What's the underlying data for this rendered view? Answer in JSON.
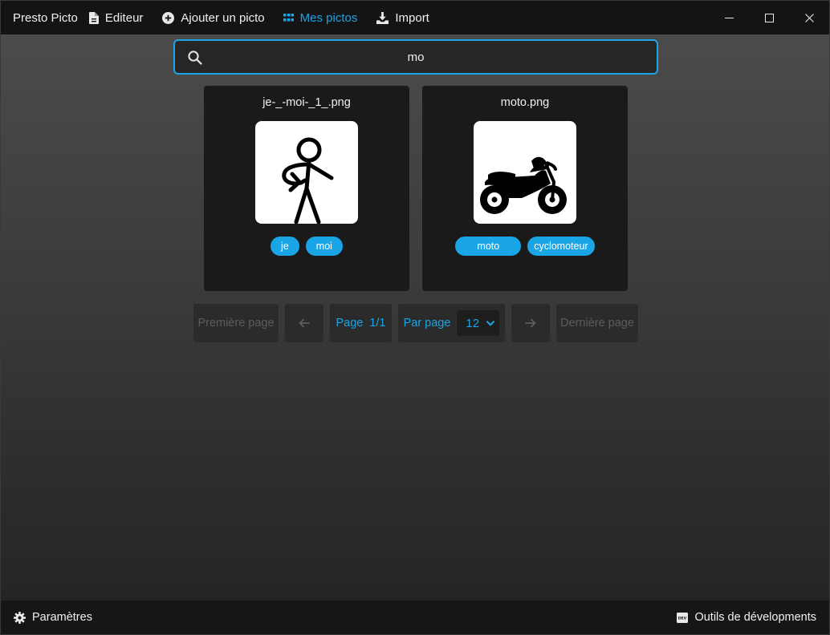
{
  "app": {
    "title": "Presto Picto"
  },
  "nav": {
    "editor": "Editeur",
    "add": "Ajouter un picto",
    "mine": "Mes pictos",
    "import": "Import"
  },
  "search": {
    "value": "mo"
  },
  "cards": [
    {
      "title": "je-_-moi-_1_.png",
      "image": "stick-figure-pointing-self",
      "tags": [
        "je",
        "moi"
      ]
    },
    {
      "title": "moto.png",
      "image": "motorcycle",
      "tags": [
        "moto",
        "cyclomoteur"
      ]
    }
  ],
  "pagination": {
    "first": "Première page",
    "prev_icon": "arrow-left-icon",
    "page_label": "Page",
    "page_value": "1/1",
    "per_page_label": "Par page",
    "per_page_value": "12",
    "next_icon": "arrow-right-icon",
    "last": "Dernière page"
  },
  "footer": {
    "settings": "Paramètres",
    "devtools": "Outils de dévelopments",
    "devtools_badge": "DEV"
  },
  "colors": {
    "accent": "#1aa5e6",
    "titlebar": "#141414",
    "card": "#1a1a1a"
  }
}
